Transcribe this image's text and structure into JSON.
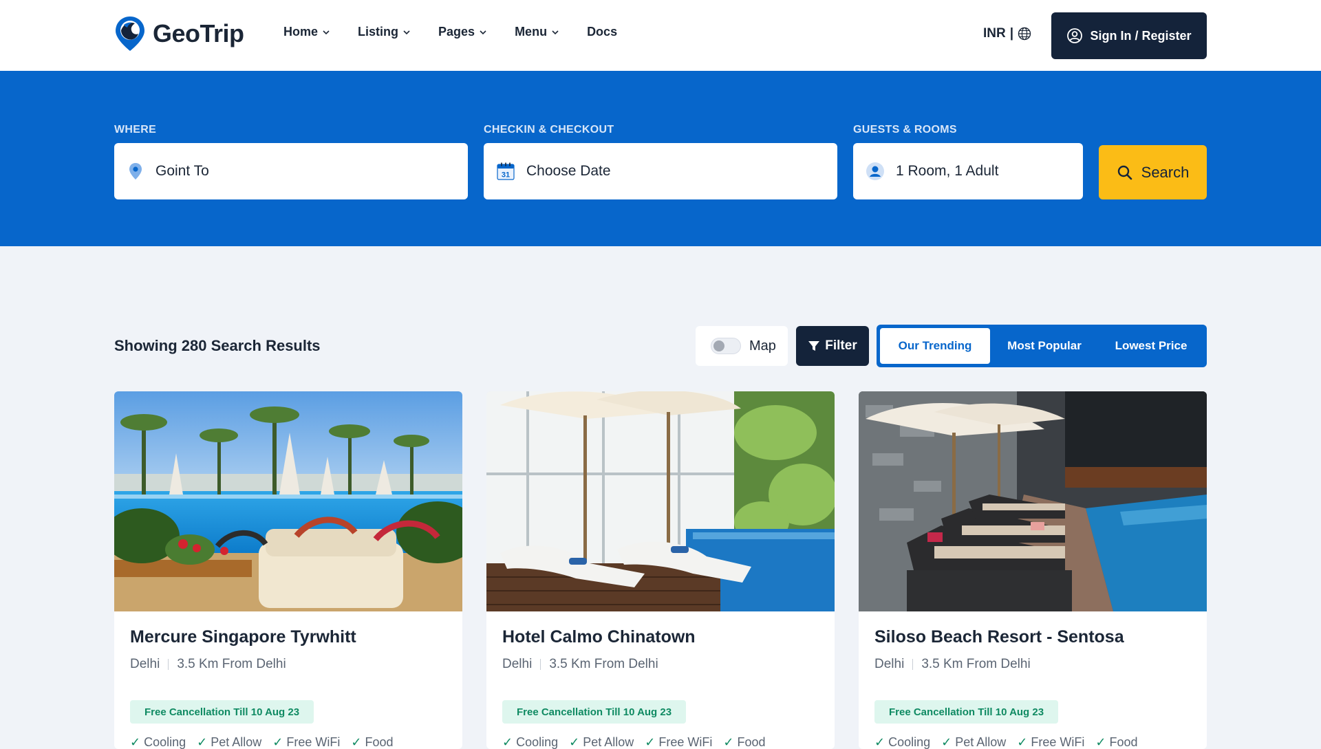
{
  "brand": {
    "name": "GeoTrip",
    "color": "#0766cb"
  },
  "nav": [
    {
      "label": "Home",
      "dropdown": true
    },
    {
      "label": "Listing",
      "dropdown": true
    },
    {
      "label": "Pages",
      "dropdown": true
    },
    {
      "label": "Menu",
      "dropdown": true
    },
    {
      "label": "Docs",
      "dropdown": false
    }
  ],
  "header": {
    "currency": "INR",
    "currency_sep": "|",
    "signin_label": "Sign In / Register"
  },
  "search": {
    "where": {
      "label": "WHERE",
      "value": "Goint To"
    },
    "dates": {
      "label": "CHECKIN & CHECKOUT",
      "value": "Choose Date",
      "calendar_day": "31"
    },
    "guests": {
      "label": "GUESTS & ROOMS",
      "value": "1 Room, 1 Adult"
    },
    "button_label": "Search"
  },
  "results": {
    "count_text": "Showing 280 Search Results",
    "map_label": "Map",
    "filter_label": "Filter",
    "sort_tabs": [
      "Our Trending",
      "Most Popular",
      "Lowest Price"
    ]
  },
  "cards": [
    {
      "title": "Mercure Singapore Tyrwhitt",
      "city": "Delhi",
      "distance": "3.5 Km From Delhi",
      "badge": "Free Cancellation Till 10 Aug 23",
      "amenities": [
        "Cooling",
        "Pet Allow",
        "Free WiFi",
        "Food"
      ]
    },
    {
      "title": "Hotel Calmo Chinatown",
      "city": "Delhi",
      "distance": "3.5 Km From Delhi",
      "badge": "Free Cancellation Till 10 Aug 23",
      "amenities": [
        "Cooling",
        "Pet Allow",
        "Free WiFi",
        "Food"
      ]
    },
    {
      "title": "Siloso Beach Resort - Sentosa",
      "city": "Delhi",
      "distance": "3.5 Km From Delhi",
      "badge": "Free Cancellation Till 10 Aug 23",
      "amenities": [
        "Cooling",
        "Pet Allow",
        "Free WiFi",
        "Food"
      ]
    }
  ],
  "icons": {
    "location": "map-pin-icon",
    "calendar": "calendar-icon",
    "guests": "user-icon",
    "search": "search-icon",
    "filter": "filter-icon",
    "globe": "globe-icon",
    "account": "user-circle-icon"
  },
  "colors": {
    "primary": "#0766cb",
    "dark": "#14233a",
    "accent": "#fbbc16",
    "badge_bg": "#def6ee",
    "badge_text": "#0f8a62"
  }
}
